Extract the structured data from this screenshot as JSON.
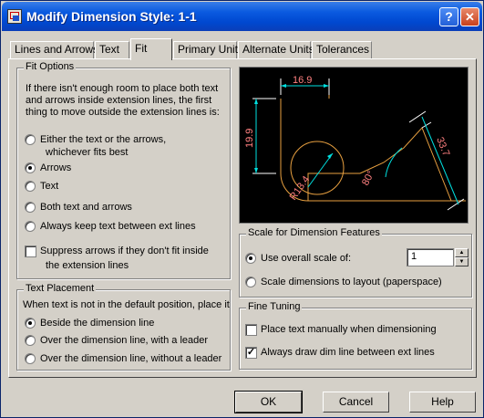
{
  "window": {
    "title": "Modify Dimension Style: 1-1",
    "help": "?",
    "close": "✕"
  },
  "tabs": [
    {
      "label": "Lines and Arrows"
    },
    {
      "label": "Text"
    },
    {
      "label": "Fit"
    },
    {
      "label": "Primary Units"
    },
    {
      "label": "Alternate Units"
    },
    {
      "label": "Tolerances"
    }
  ],
  "active_tab": "Fit",
  "fit_options": {
    "title": "Fit Options",
    "description": [
      "If there isn't enough room to place both text",
      "and arrows inside extension lines, the first",
      "thing to move outside the extension lines is:"
    ],
    "options": [
      {
        "label": "Either the text or the arrows,",
        "label2": "whichever fits best",
        "selected": false
      },
      {
        "label": "Arrows",
        "selected": true
      },
      {
        "label": "Text",
        "selected": false
      },
      {
        "label": "Both text and arrows",
        "selected": false
      },
      {
        "label": "Always keep text between ext lines",
        "selected": false
      }
    ],
    "suppress": {
      "label": "Suppress arrows if they don't fit inside",
      "label2": "the extension lines",
      "checked": false
    }
  },
  "text_placement": {
    "title": "Text Placement",
    "description": "When text is not in the default position, place it",
    "options": [
      {
        "label": "Beside the dimension line",
        "selected": true
      },
      {
        "label": "Over the dimension line, with a leader",
        "selected": false
      },
      {
        "label": "Over the dimension line, without a leader",
        "selected": false
      }
    ]
  },
  "preview": {
    "dims": [
      "16.9",
      "19.9",
      "33.7",
      "R13.4",
      "80°"
    ],
    "colors": {
      "background": "#000000",
      "dimension": "#00e0e0",
      "text": "#ff8080",
      "geometry": "#e8a040",
      "extension": "#ffffff"
    }
  },
  "scale": {
    "title": "Scale for Dimension Features",
    "overall_label": "Use overall scale of:",
    "overall_selected": true,
    "overall_value": "1",
    "layout_label": "Scale dimensions to layout (paperspace)",
    "layout_selected": false
  },
  "fine_tuning": {
    "title": "Fine Tuning",
    "manual": {
      "label": "Place text manually when dimensioning",
      "checked": false
    },
    "always_draw": {
      "label": "Always draw dim line between ext lines",
      "checked": true
    }
  },
  "buttons": {
    "ok": "OK",
    "cancel": "Cancel",
    "help": "Help"
  },
  "check_mark": "✓"
}
